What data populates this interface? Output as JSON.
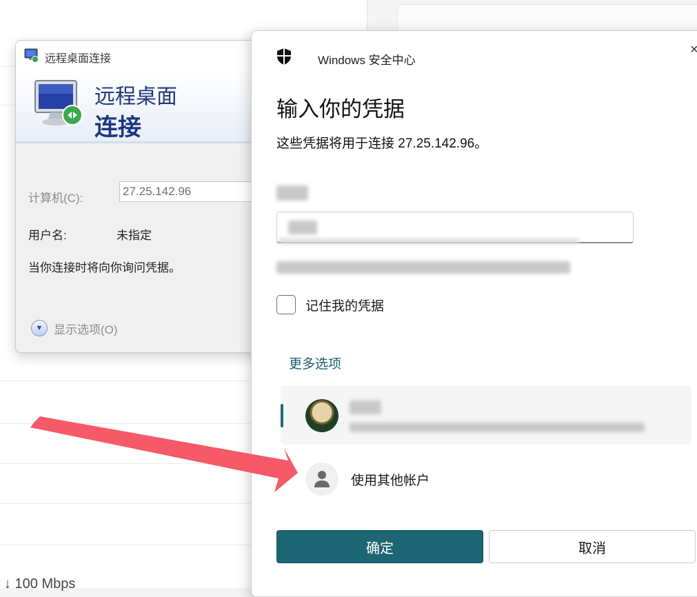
{
  "background": {
    "network_speed": "↓ 100 Mbps"
  },
  "rdp_window": {
    "title": "远程桌面连接",
    "banner_line1": "远程桌面",
    "banner_line2": "连接",
    "computer_label": "计算机(C):",
    "computer_value": "27.25.142.96",
    "username_label": "用户名:",
    "username_value": "未指定",
    "note": "当你连接时将向你询问凭据。",
    "show_options": "显示选项(O)",
    "icons": {
      "title": "rdp-monitor-icon",
      "banner": "rdp-monitor-icon",
      "options": "chevron-down-icon"
    }
  },
  "security_dialog": {
    "app_title": "Windows 安全中心",
    "close_glyph": "×",
    "heading": "输入你的凭据",
    "description": "这些凭据将用于连接 27.25.142.96。",
    "remember_label": "记住我的凭据",
    "more_options": "更多选项",
    "other_account_label": "使用其他帐户",
    "ok_label": "确定",
    "cancel_label": "取消",
    "icons": {
      "header": "shield-icon",
      "other_account": "person-icon"
    },
    "accent_color": "#1d6674"
  },
  "annotation": {
    "arrow_color": "#f5505f"
  }
}
